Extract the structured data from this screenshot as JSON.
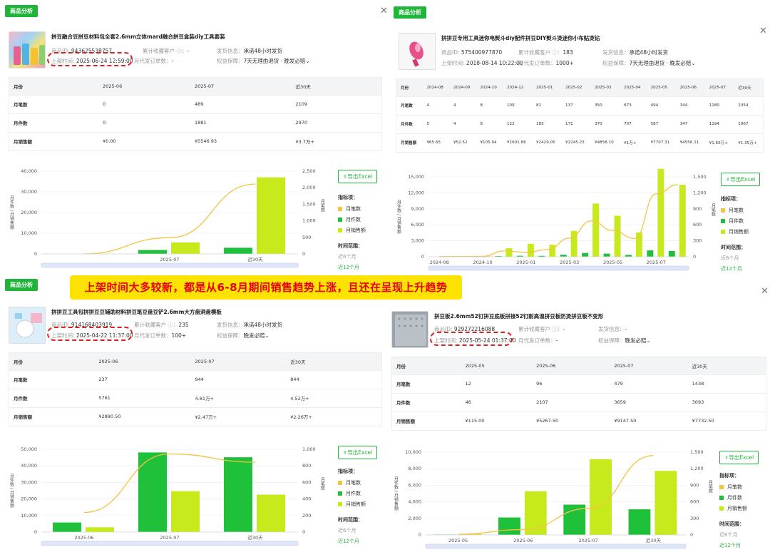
{
  "banner": "上架时间大多较新，都是从6-8月期间销售趋势上涨，且还在呈现上升趋势",
  "panels": [
    {
      "tag": "商品分析",
      "title": "拼豆融合豆拼豆材料包全套2.6mm立体mard融合拼豆盒装diy工具套装",
      "pid_label": "商品ID:",
      "pid": "943625538757",
      "fav_label": "累计收藏客户 ⓘ：",
      "fav": "-",
      "ship_label": "发货信息：",
      "ship": "承诺48小时发货",
      "date_label": "上架时间:",
      "date": "2025-06-24 12:59:00",
      "order_label": "月代发订单数：",
      "order": "-",
      "guar_label": "权益保障：",
      "guar": "7天无理由退货 · 晚发必赔⌄",
      "table": {
        "headers": [
          "月份",
          "2025-06",
          "2025-07",
          "近30天"
        ],
        "rows": [
          [
            "月笔数",
            "0",
            "489",
            "2109"
          ],
          [
            "月件数",
            "0",
            "1881",
            "2970"
          ],
          [
            "月销售额",
            "¥0.00",
            "¥5546.93",
            "¥3.7万+"
          ]
        ]
      },
      "excel": "⇪导出Excel",
      "legend": {
        "title": "指标项：",
        "items": [
          "月笔数",
          "月件数",
          "月销售额"
        ],
        "range": "时间范围：",
        "opt1": "近6个月",
        "opt2": "近12个月"
      },
      "yleft_label": "月件数 / 月销售额",
      "yright_label": "月笔数",
      "chart_data": {
        "type": "bar",
        "categories": [
          "2025-06",
          "2025-07",
          "近30天"
        ],
        "series": [
          {
            "name": "月笔数",
            "type": "line",
            "color": "#f5c242",
            "axis": "right",
            "values": [
              0,
              489,
              2109
            ]
          },
          {
            "name": "月件数",
            "type": "bar",
            "color": "#1fc13a",
            "values": [
              0,
              1881,
              2970
            ]
          },
          {
            "name": "月销售额",
            "type": "bar",
            "color": "#c6ea1c",
            "values": [
              0,
              5546.93,
              37000
            ]
          }
        ],
        "ylim_left": [
          0,
          40000
        ],
        "yticks_left": [
          "0",
          "10,000",
          "20,000",
          "30,000",
          "40,000"
        ],
        "ylim_right": [
          0,
          2500
        ],
        "yticks_right": [
          "0",
          "500",
          "1,000",
          "1,500",
          "2,000",
          "2,500"
        ],
        "xlabels": [
          "2025-06",
          "2025-07",
          "近30天"
        ],
        "xlabel_show": [
          false,
          true,
          true
        ]
      }
    },
    {
      "tag": "商品分析",
      "title": "拼拼豆专用工具迷你电熨斗diy配件拼豆DIY熨斗烫迷你小布贴烫钻",
      "pid_label": "商品ID:",
      "pid": "575400977870",
      "fav_label": "累计收藏客户 ⓘ：",
      "fav": "183",
      "ship_label": "发货信息：",
      "ship": "承诺48小时发货",
      "date_label": "上架时间:",
      "date": "2018-08-14 10:22:00",
      "order_label": "月代发订单数：",
      "order": "1000+",
      "guar_label": "权益保障：",
      "guar": "7天无理由退货 · 晚发必赔⌄",
      "table": {
        "headers": [
          "月份",
          "2024-08",
          "2024-09",
          "2024-10",
          "2024-12",
          "2025-01",
          "2025-02",
          "2025-03",
          "2025-04",
          "2025-05",
          "2025-06",
          "2025-07",
          "近30天"
        ],
        "rows": [
          [
            "月笔数",
            "4",
            "4",
            "8",
            "109",
            "81",
            "137",
            "350",
            "673",
            "494",
            "344",
            "1180",
            "1354"
          ],
          [
            "月件数",
            "5",
            "4",
            "8",
            "122",
            "185",
            "171",
            "370",
            "707",
            "587",
            "347",
            "1194",
            "1067"
          ],
          [
            "月销售额",
            "¥65.65",
            "¥52.52",
            "¥105.04",
            "¥1601.86",
            "¥2429.05",
            "¥2245.23",
            "¥4858.10",
            "¥1万+",
            "¥7707.31",
            "¥4556.11",
            "¥1.65万+",
            "¥1.35万+"
          ]
        ]
      },
      "excel": "⇪导出Excel",
      "legend": {
        "title": "指标项：",
        "items": [
          "月笔数",
          "月件数",
          "月销售额"
        ],
        "range": "时间范围：",
        "opt1": "近6个月",
        "opt2": "近12个月"
      },
      "yleft_label": "月件数 / 月销售额",
      "yright_label": "月笔数",
      "chart_data": {
        "type": "bar",
        "categories": [
          "2024-08",
          "2024-09",
          "2024-10",
          "2024-12",
          "2025-01",
          "2025-02",
          "2025-03",
          "2025-04",
          "2025-05",
          "2025-06",
          "2025-07",
          "近30天"
        ],
        "series": [
          {
            "name": "月笔数",
            "type": "line",
            "color": "#f5c242",
            "axis": "right",
            "values": [
              4,
              4,
              8,
              109,
              81,
              137,
              350,
              673,
              494,
              344,
              1180,
              1354
            ]
          },
          {
            "name": "月件数",
            "type": "bar",
            "color": "#1fc13a",
            "values": [
              5,
              4,
              8,
              122,
              185,
              171,
              370,
              707,
              587,
              347,
              1194,
              1067
            ]
          },
          {
            "name": "月销售额",
            "type": "bar",
            "color": "#c6ea1c",
            "values": [
              65.65,
              52.52,
              105.04,
              1601.86,
              2429.05,
              2245.23,
              4858.1,
              10000,
              7707.31,
              4556.11,
              16500,
              13500
            ]
          }
        ],
        "ylim_left": [
          0,
          15000
        ],
        "yticks_left": [
          "0",
          "3,000",
          "6,000",
          "9,000",
          "12,000",
          "15,000"
        ],
        "ylim_right": [
          0,
          1500
        ],
        "yticks_right": [
          "0",
          "300",
          "600",
          "900",
          "1,200",
          "1,500"
        ],
        "xlabels": [
          "2024-08",
          "2024-10",
          "2025-01",
          "2025-03",
          "2025-05",
          "2025-07"
        ],
        "xlabel_show": [
          true,
          false,
          true,
          false,
          true,
          false,
          true,
          false,
          true,
          false,
          true,
          false
        ]
      }
    },
    {
      "tag": "商品分析",
      "title": "拼拼豆工具包拼拼豆豆辅助材料拼豆笔豆盘豆铲2.6mm大方盘洞盘模板",
      "pid_label": "商品ID:",
      "pid": "914168403919",
      "fav_label": "累计收藏客户 ⓘ：",
      "fav": "235",
      "ship_label": "发货信息：",
      "ship": "承诺48小时发货",
      "date_label": "上架时间:",
      "date": "2025-04-22 11:37:00",
      "order_label": "月代发订单数：",
      "order": "100+",
      "guar_label": "权益保障：",
      "guar": "晚发必赔⌄",
      "table": {
        "headers": [
          "月份",
          "2025-06",
          "2025-07",
          "近30天"
        ],
        "rows": [
          [
            "月笔数",
            "237",
            "944",
            "844"
          ],
          [
            "月件数",
            "5761",
            "4.81万+",
            "4.52万+"
          ],
          [
            "月销售额",
            "¥2880.50",
            "¥2.47万+",
            "¥2.26万+"
          ]
        ]
      },
      "excel": "⇪导出Excel",
      "legend": {
        "title": "指标项：",
        "items": [
          "月笔数",
          "月件数",
          "月销售额"
        ],
        "range": "时间范围：",
        "opt1": "近6个月",
        "opt2": "近12个月"
      },
      "yleft_label": "月件数 / 月销售额",
      "yright_label": "月笔数",
      "chart_data": {
        "type": "bar",
        "categories": [
          "2025-06",
          "2025-07",
          "近30天"
        ],
        "series": [
          {
            "name": "月笔数",
            "type": "line",
            "color": "#f5c242",
            "axis": "right",
            "values": [
              237,
              944,
              844
            ]
          },
          {
            "name": "月件数",
            "type": "bar",
            "color": "#1fc13a",
            "values": [
              5761,
              48100,
              45200
            ]
          },
          {
            "name": "月销售额",
            "type": "bar",
            "color": "#c6ea1c",
            "values": [
              2880.5,
              24700,
              22600
            ]
          }
        ],
        "ylim_left": [
          0,
          50000
        ],
        "yticks_left": [
          "0",
          "10,000",
          "20,000",
          "30,000",
          "40,000",
          "50,000"
        ],
        "ylim_right": [
          0,
          1000
        ],
        "yticks_right": [
          "0",
          "200",
          "400",
          "600",
          "800",
          "1,000"
        ],
        "xlabels": [
          "2025-06",
          "2025-07",
          "近30天"
        ],
        "xlabel_show": [
          true,
          true,
          true
        ]
      }
    },
    {
      "tag": "",
      "title": "拼豆板2.6mm52钉拼豆底板拼接52钉耐高温拼豆板防烫拼豆板不变形",
      "pid_label": "商品ID:",
      "pid": "929272216088",
      "fav_label": "累计收藏客户 ⓘ：",
      "fav": "-",
      "ship_label": "发货信息：",
      "ship": "-",
      "date_label": "上架时间:",
      "date": "2025-05-24 01:37:00",
      "order_label": "月代发订单数：",
      "order": "-",
      "guar_label": "权益保障：",
      "guar": "晚发必赔⌄",
      "table": {
        "headers": [
          "月份",
          "2025-05",
          "2025-06",
          "2025-07",
          "近30天"
        ],
        "rows": [
          [
            "月笔数",
            "12",
            "96",
            "479",
            "1438"
          ],
          [
            "月件数",
            "46",
            "2107",
            "3659",
            "3093"
          ],
          [
            "月销售额",
            "¥115.00",
            "¥5267.50",
            "¥9147.50",
            "¥7732.50"
          ]
        ]
      },
      "excel": "⇪导出Excel",
      "legend": {
        "title": "指标项：",
        "items": [
          "月笔数",
          "月件数",
          "月销售额"
        ],
        "range": "时间范围：",
        "opt1": "近6个月",
        "opt2": "近12个月"
      },
      "yleft_label": "月件数 / 月销售额",
      "yright_label": "月笔数",
      "chart_data": {
        "type": "bar",
        "categories": [
          "2025-05",
          "2025-06",
          "2025-07",
          "近30天"
        ],
        "series": [
          {
            "name": "月笔数",
            "type": "line",
            "color": "#f5c242",
            "axis": "right",
            "values": [
              12,
              96,
              479,
              1438
            ]
          },
          {
            "name": "月件数",
            "type": "bar",
            "color": "#1fc13a",
            "values": [
              46,
              2107,
              3659,
              3093
            ]
          },
          {
            "name": "月销售额",
            "type": "bar",
            "color": "#c6ea1c",
            "values": [
              115,
              5267.5,
              9147.5,
              7732.5
            ]
          }
        ],
        "ylim_left": [
          0,
          10000
        ],
        "yticks_left": [
          "0",
          "2,000",
          "4,000",
          "6,000",
          "8,000",
          "10,000"
        ],
        "ylim_right": [
          0,
          1500
        ],
        "yticks_right": [
          "0",
          "300",
          "600",
          "900",
          "1,200",
          "1,500"
        ],
        "xlabels": [
          "2025-05",
          "2025-06",
          "2025-07",
          "近30天"
        ],
        "xlabel_show": [
          true,
          true,
          true,
          true
        ]
      }
    }
  ]
}
